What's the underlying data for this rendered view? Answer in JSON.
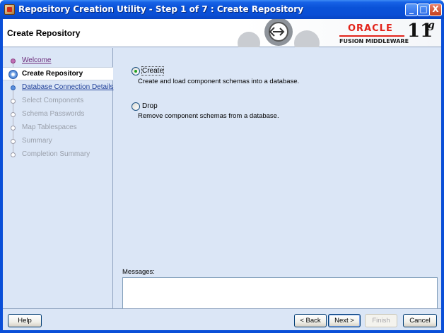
{
  "window": {
    "title": "Repository Creation Utility - Step 1 of 7 : Create Repository",
    "controls": {
      "minimize": "_",
      "maximize": "□",
      "close": "X"
    }
  },
  "header": {
    "title": "Create Repository",
    "brand": "ORACLE",
    "brand_sub": "FUSION MIDDLEWARE",
    "version": "11",
    "version_suffix": "g"
  },
  "nav": {
    "items": [
      {
        "label": "Welcome",
        "state": "visited"
      },
      {
        "label": "Create Repository",
        "state": "active"
      },
      {
        "label": "Database Connection Details",
        "state": "link"
      },
      {
        "label": "Select Components",
        "state": "disabled"
      },
      {
        "label": "Schema Passwords",
        "state": "disabled"
      },
      {
        "label": "Map Tablespaces",
        "state": "disabled"
      },
      {
        "label": "Summary",
        "state": "disabled"
      },
      {
        "label": "Completion Summary",
        "state": "disabled"
      }
    ]
  },
  "main": {
    "options": [
      {
        "label": "Create",
        "description": "Create and load component schemas into a database.",
        "checked": true
      },
      {
        "label": "Drop",
        "description": "Remove component schemas from a database.",
        "checked": false
      }
    ],
    "messages_label": "Messages:",
    "messages_value": ""
  },
  "footer": {
    "help": "Help",
    "back": "< Back",
    "next": "Next >",
    "finish": "Finish",
    "cancel": "Cancel"
  },
  "colors": {
    "titlebar": "#0a52d8",
    "panel_bg": "#dbe6f6",
    "oracle_red": "#e2231a",
    "visited_link": "#6b2a7a",
    "link": "#1f3f99"
  }
}
